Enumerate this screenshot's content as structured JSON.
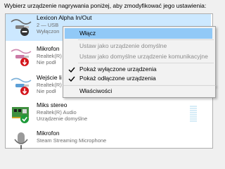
{
  "instruction_text": "Wybierz urządzenie nagrywania poniżej, aby zmodyfikować jego ustawienia:",
  "devices": [
    {
      "name": "Lexicon Alpha In/Out",
      "line1": "2 — USB",
      "line2": "Wyłączon",
      "icon": "audio-jack-icon",
      "status": "disabled",
      "selected": true
    },
    {
      "name": "Mikrofon",
      "line1": "Realtek(R)",
      "line2": "Nie podł",
      "icon": "audio-jack-icon",
      "status": "unplugged"
    },
    {
      "name": "Wejście li",
      "line1": "Realtek(R)",
      "line2": "Nie podł",
      "icon": "audio-jack-icon",
      "status": "unplugged"
    },
    {
      "name": "Miks stereo",
      "line1": "Realtek(R) Audio",
      "line2": "Urządzenie domyślne",
      "icon": "sound-card-icon",
      "status": "default",
      "level": 0
    },
    {
      "name": "Mikrofon",
      "line1": "Steam Streaming Microphone",
      "line2": "",
      "icon": "microphone-icon",
      "status": "none"
    }
  ],
  "context_menu": {
    "items": [
      {
        "label": "Włącz",
        "state": "hover"
      },
      {
        "label": "Ustaw jako urządzenie domyślne",
        "state": "disabled"
      },
      {
        "label": "Ustaw jako domyślne urządzenie komunikacyjne",
        "state": "disabled"
      },
      {
        "label": "Pokaż wyłączone urządzenia",
        "state": "checked"
      },
      {
        "label": "Pokaż odłączone urządzenia",
        "state": "checked"
      },
      {
        "label": "Właściwości",
        "state": "normal"
      }
    ]
  },
  "colors": {
    "selection": "#cce8ff",
    "menu_hover": "#91c9f7",
    "status_disabled": "#333333",
    "status_unplugged": "#d4161d",
    "status_default": "#1f9a3a",
    "level_meter": "#d6ecf7"
  }
}
